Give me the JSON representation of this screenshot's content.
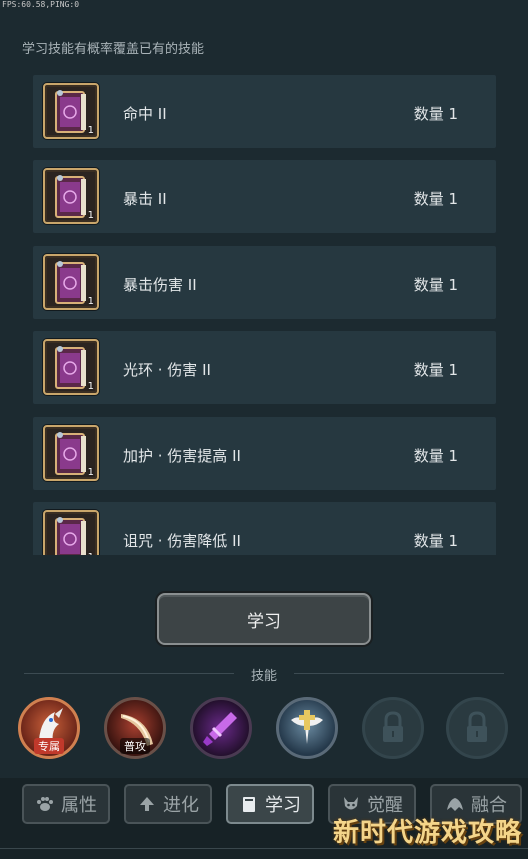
{
  "hud": {
    "fps": "FPS:60.58,PING:0"
  },
  "hint": "学习技能有概率覆盖已有的技能",
  "books": [
    {
      "name": "命中 II",
      "qty": "数量 1",
      "count": "1"
    },
    {
      "name": "暴击 II",
      "qty": "数量 1",
      "count": "1"
    },
    {
      "name": "暴击伤害 II",
      "qty": "数量 1",
      "count": "1"
    },
    {
      "name": "光环 · 伤害 II",
      "qty": "数量 1",
      "count": "1"
    },
    {
      "name": "加护 · 伤害提高 II",
      "qty": "数量 1",
      "count": "1"
    },
    {
      "name": "诅咒 · 伤害降低 II",
      "qty": "数量 1",
      "count": "1"
    }
  ],
  "learn_button": "学习",
  "skills": {
    "label": "技能",
    "slots": [
      {
        "tag": "专属",
        "icon": "dragon-skill-icon",
        "locked": false
      },
      {
        "tag": "普攻",
        "icon": "blade-skill-icon",
        "locked": false
      },
      {
        "tag": "",
        "icon": "purple-sword-skill-icon",
        "locked": false
      },
      {
        "tag": "",
        "icon": "holy-cross-skill-icon",
        "locked": false
      },
      {
        "tag": "",
        "icon": "lock-icon",
        "locked": true
      },
      {
        "tag": "",
        "icon": "lock-icon",
        "locked": true
      }
    ]
  },
  "tabs": [
    {
      "label": "属性",
      "icon": "paw-icon"
    },
    {
      "label": "进化",
      "icon": "up-arrow-icon"
    },
    {
      "label": "学习",
      "icon": "book-icon",
      "active": true
    },
    {
      "label": "觉醒",
      "icon": "demon-icon"
    },
    {
      "label": "融合",
      "icon": "beast-icon"
    }
  ],
  "watermark": "新时代游戏攻略",
  "colors": {
    "background": "#1c2a30",
    "row": "#263840",
    "slot_border": "#c9a66b",
    "book_purple": "#8a3a8c",
    "exclusive_tag": "#c0392b"
  }
}
